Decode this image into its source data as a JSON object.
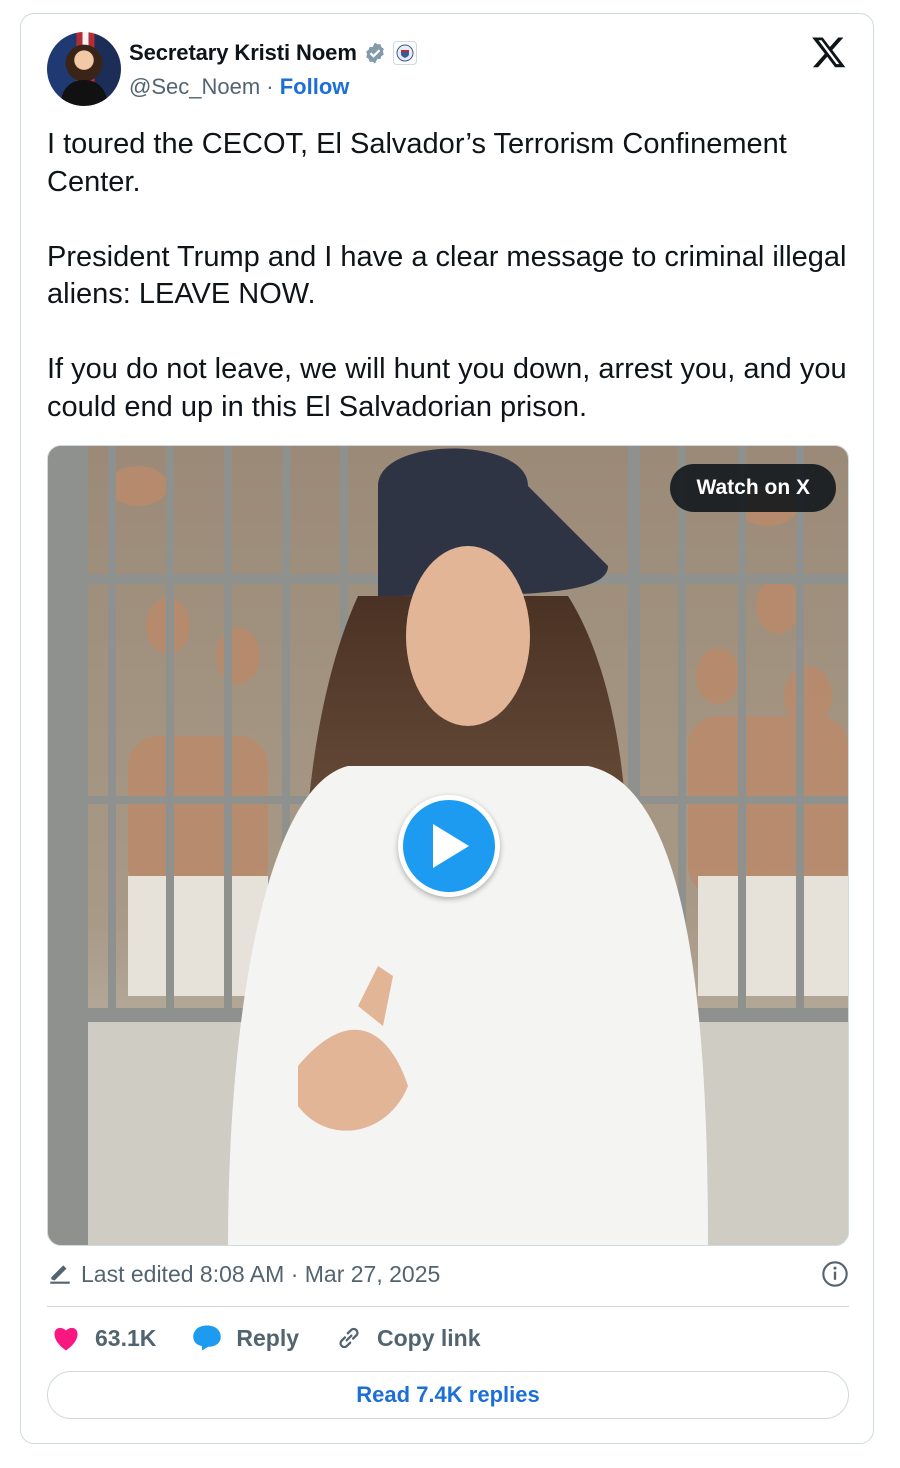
{
  "author": {
    "display_name": "Secretary Kristi Noem",
    "handle": "@Sec_Noem",
    "separator": " · ",
    "follow_label": "Follow"
  },
  "tweet": {
    "text": "I toured the CECOT, El Salvador’s Terrorism Confinement Center.\n\nPresident Trump and I have a clear message to criminal illegal aliens: LEAVE NOW.\n\nIf you do not leave, we will hunt you down, arrest you, and you could end up in this El Salvadorian prison."
  },
  "media": {
    "watch_label": "Watch on X"
  },
  "meta": {
    "edited_text": "Last edited 8:08 AM · Mar 27, 2025"
  },
  "actions": {
    "likes": "63.1K",
    "reply_label": "Reply",
    "copy_label": "Copy link",
    "read_replies_label": "Read 7.4K replies"
  },
  "colors": {
    "like": "#f91880",
    "link": "#1d6fd8",
    "verified": "#829aab",
    "play": "#1d9bf0"
  },
  "icons": [
    "verified-badge-icon",
    "government-seal-icon",
    "x-logo-icon",
    "play-icon",
    "edit-pencil-icon",
    "info-icon",
    "heart-icon",
    "reply-bubble-icon",
    "link-icon"
  ]
}
